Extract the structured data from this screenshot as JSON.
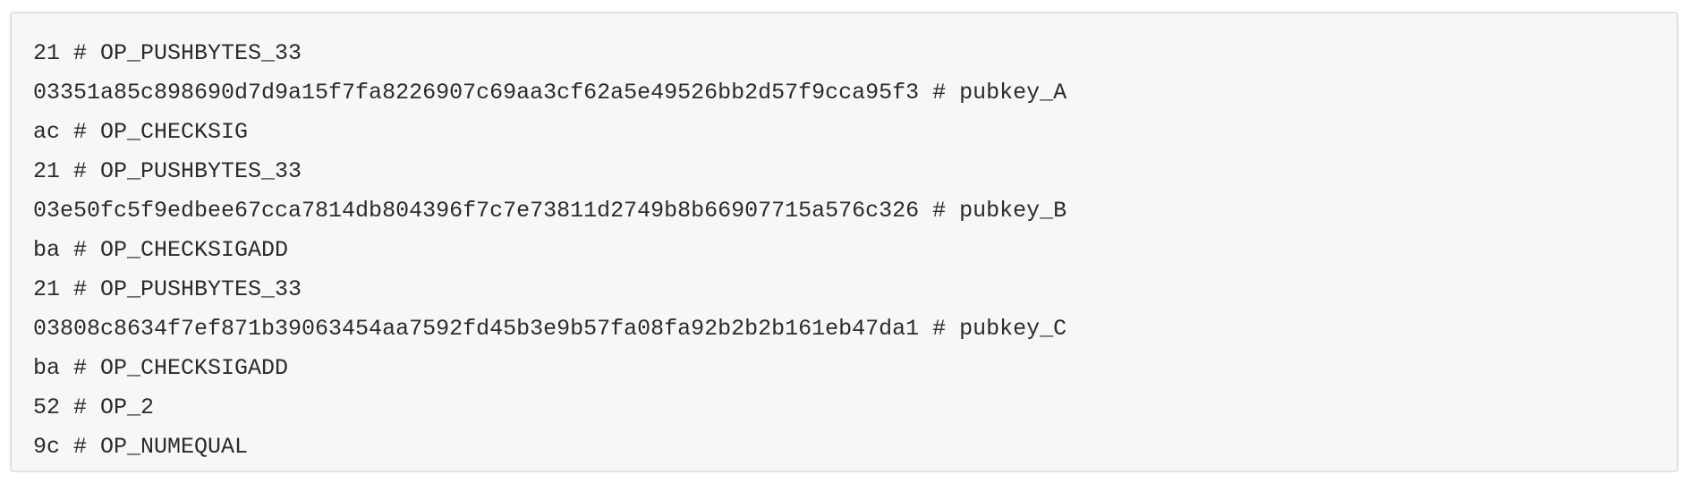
{
  "code_block": {
    "lines": [
      "21 # OP_PUSHBYTES_33",
      "03351a85c898690d7d9a15f7fa8226907c69aa3cf62a5e49526bb2d57f9cca95f3 # pubkey_A",
      "ac # OP_CHECKSIG",
      "21 # OP_PUSHBYTES_33",
      "03e50fc5f9edbee67cca7814db804396f7c7e73811d2749b8b66907715a576c326 # pubkey_B",
      "ba # OP_CHECKSIGADD",
      "21 # OP_PUSHBYTES_33",
      "03808c8634f7ef871b39063454aa7592fd45b3e9b57fa08fa92b2b2b161eb47da1 # pubkey_C",
      "ba # OP_CHECKSIGADD",
      "52 # OP_2",
      "9c # OP_NUMEQUAL"
    ]
  }
}
